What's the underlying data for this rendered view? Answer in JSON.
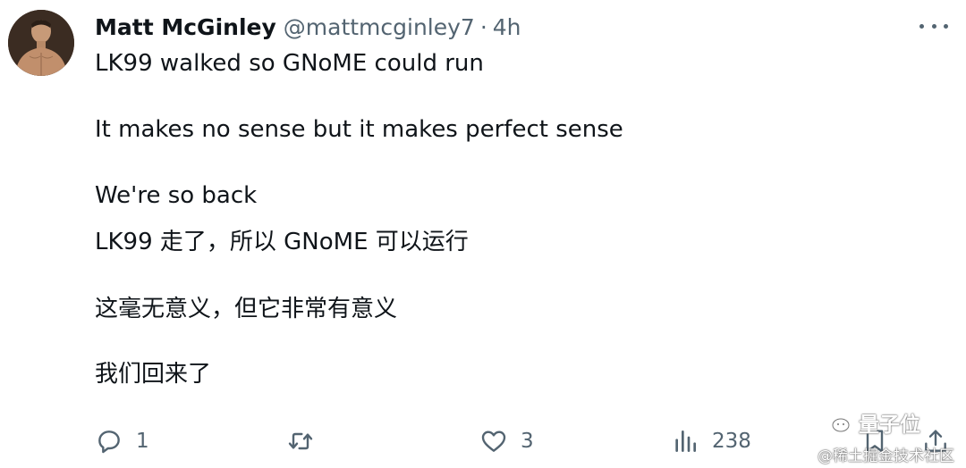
{
  "author": {
    "name": "Matt McGinley",
    "handle": "@mattmcginley7",
    "separator": "·",
    "time": "4h"
  },
  "tweet": {
    "lines_en": [
      "LK99 walked so GNoME could run",
      "It makes no sense but it makes perfect sense",
      "We're so back"
    ],
    "lines_zh": [
      "LK99 走了，所以 GNoME 可以运行",
      "这毫无意义，但它非常有意义",
      "我们回来了"
    ]
  },
  "actions": {
    "reply_count": "1",
    "retweet_count": "",
    "like_count": "3",
    "views_count": "238"
  },
  "icons": {
    "more": "more-horizontal-icon",
    "reply": "reply-icon",
    "retweet": "retweet-icon",
    "like": "heart-icon",
    "views": "views-chart-icon",
    "bookmark": "bookmark-icon",
    "share": "share-icon"
  },
  "watermark": {
    "brand": "量子位",
    "source": "@稀土掘金技术社区"
  },
  "colors": {
    "text": "#0f1419",
    "secondary": "#536471",
    "background": "#ffffff"
  }
}
